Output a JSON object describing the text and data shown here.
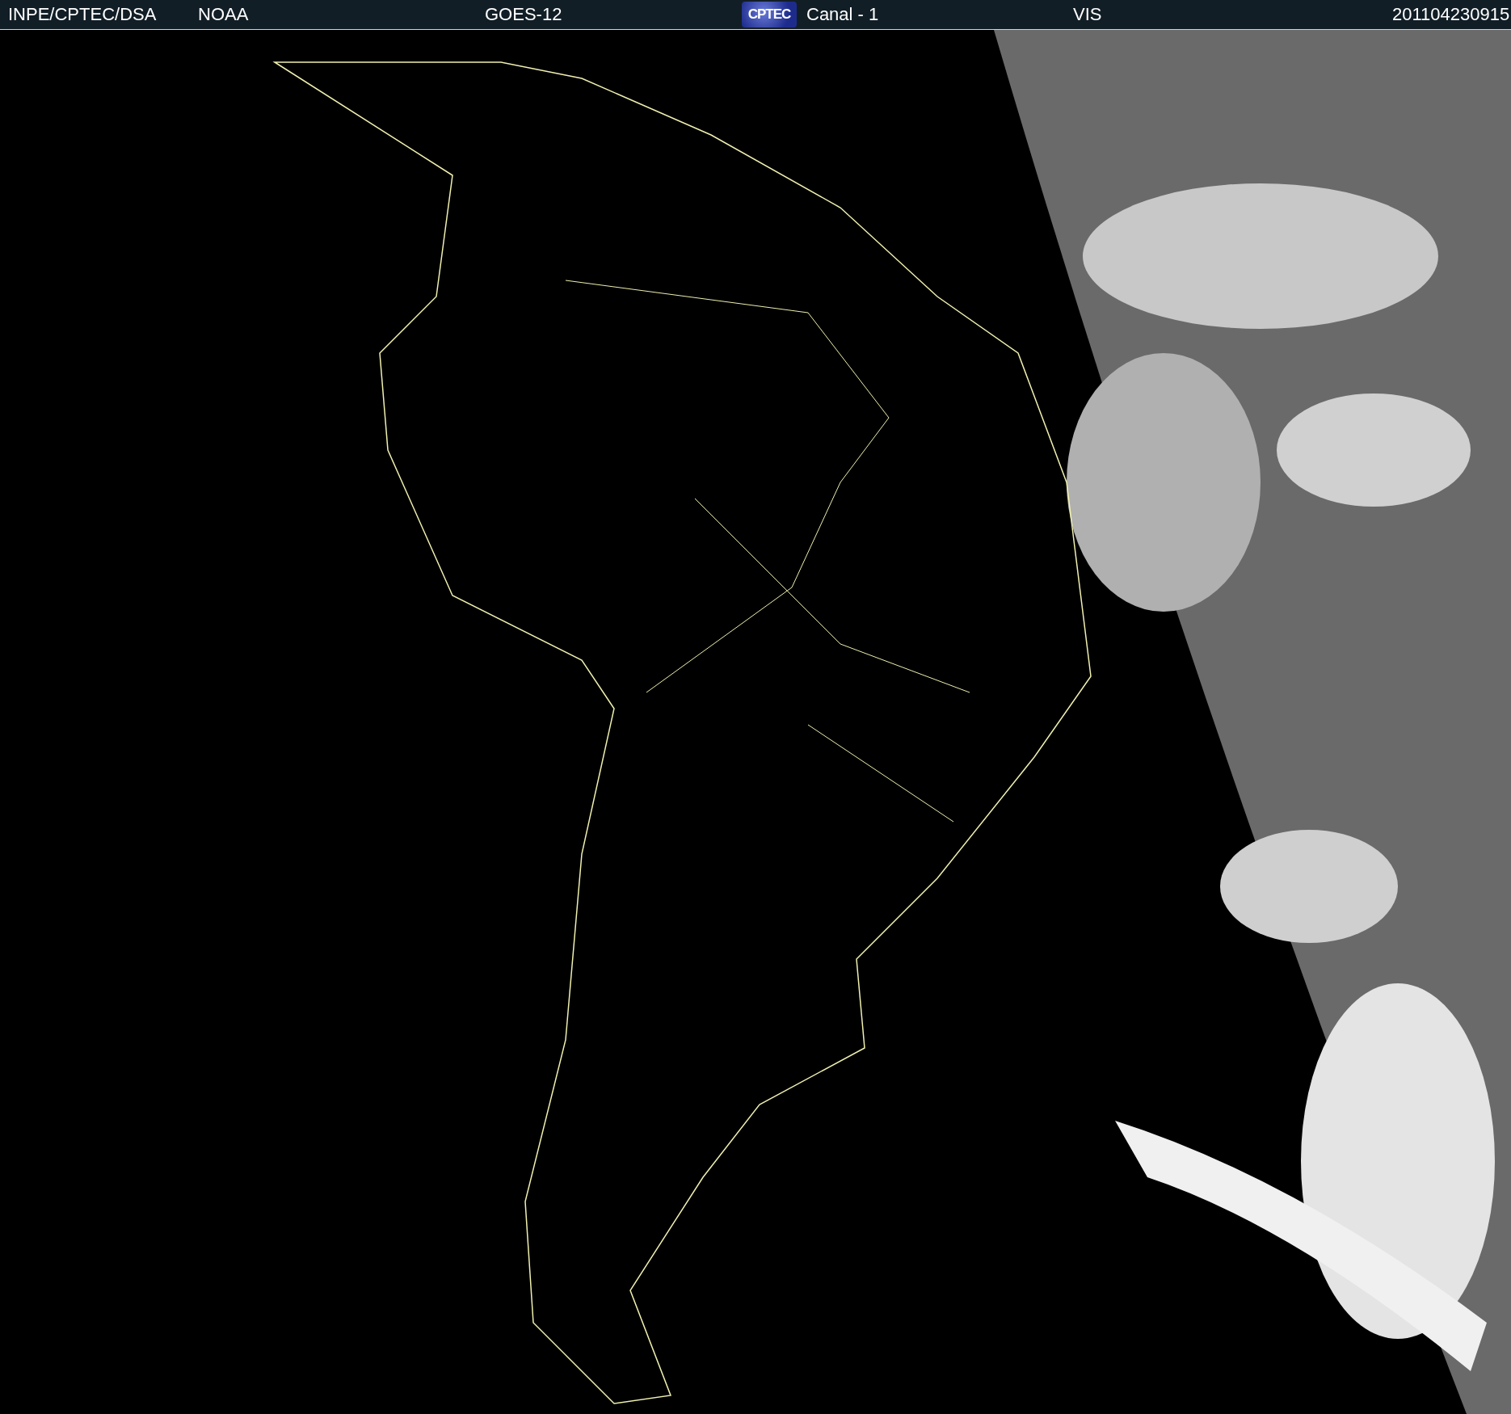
{
  "header": {
    "source": "INPE/CPTEC/DSA",
    "agency": "NOAA",
    "satellite": "GOES-12",
    "logo": "CPTEC",
    "channel": "Canal - 1",
    "band": "VIS",
    "timestamp": "201104230915"
  }
}
